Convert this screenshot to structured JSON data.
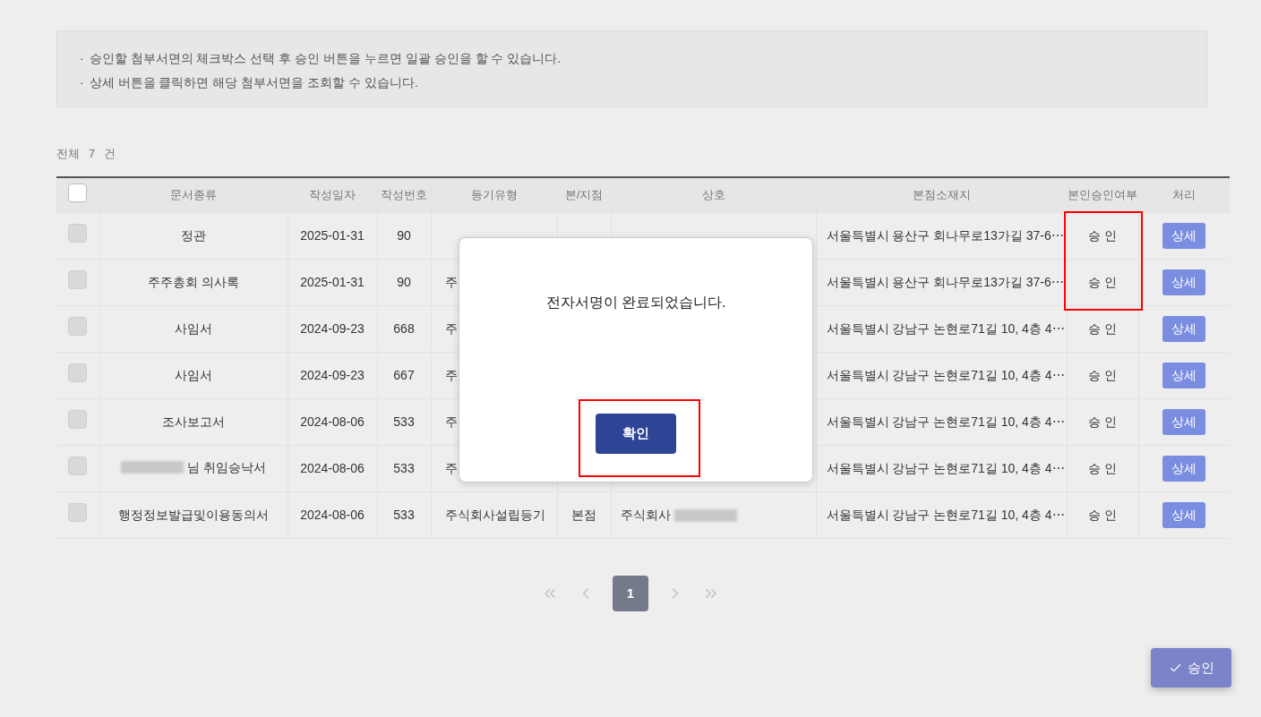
{
  "notice": [
    "승인할 첨부서면의 체크박스 선택 후 승인 버튼을 누르면 일괄 승인을 할 수 있습니다.",
    "상세 버튼을 클릭하면 해당 첨부서면을 조회할 수 있습니다."
  ],
  "bullet": "·",
  "total": {
    "prefix": "전체",
    "count": "7",
    "suffix": "건"
  },
  "table": {
    "select_all": {
      "checked": false
    },
    "columns": [
      "문서종류",
      "작성일자",
      "작성번호",
      "등기유형",
      "본/지점",
      "상호",
      "본점소재지",
      "본인승인여부",
      "처리"
    ],
    "rows": [
      {
        "checked": false,
        "doc_type": [
          {
            "kind": "text",
            "text": "정관"
          }
        ],
        "date": "2025-01-31",
        "number": "90",
        "address": "서울특별시 용산구 회나무로13가길 37-6⋯",
        "approval": "승 인",
        "action": "상세"
      },
      {
        "checked": false,
        "doc_type": [
          {
            "kind": "text",
            "text": "주주총회 의사록"
          }
        ],
        "date": "2025-01-31",
        "number": "90",
        "reg_type": "주",
        "address": "서울특별시 용산구 회나무로13가길 37-6⋯",
        "approval": "승 인",
        "action": "상세"
      },
      {
        "checked": false,
        "doc_type": [
          {
            "kind": "text",
            "text": "사임서"
          }
        ],
        "date": "2024-09-23",
        "number": "668",
        "reg_type": "주",
        "address": "서울특별시 강남구 논현로71길 10, 4층 4⋯",
        "approval": "승 인",
        "action": "상세"
      },
      {
        "checked": false,
        "doc_type": [
          {
            "kind": "text",
            "text": "사임서"
          }
        ],
        "date": "2024-09-23",
        "number": "667",
        "reg_type": "주",
        "address": "서울특별시 강남구 논현로71길 10, 4층 4⋯",
        "approval": "승 인",
        "action": "상세"
      },
      {
        "checked": false,
        "doc_type": [
          {
            "kind": "text",
            "text": "조사보고서"
          }
        ],
        "date": "2024-08-06",
        "number": "533",
        "reg_type": "주",
        "address": "서울특별시 강남구 논현로71길 10, 4층 4⋯",
        "approval": "승 인",
        "action": "상세"
      },
      {
        "checked": false,
        "doc_type": [
          {
            "kind": "redacted"
          },
          {
            "kind": "text",
            "text": "님 취임승낙서"
          }
        ],
        "date": "2024-08-06",
        "number": "533",
        "reg_type": "주",
        "address": "서울특별시 강남구 논현로71길 10, 4층 4⋯",
        "approval": "승 인",
        "action": "상세"
      },
      {
        "checked": false,
        "doc_type": [
          {
            "kind": "text",
            "text": "행정정보발급및이용동의서"
          }
        ],
        "date": "2024-08-06",
        "number": "533",
        "reg_type": "주식회사설립등기",
        "branch": "본점",
        "company": [
          {
            "kind": "text",
            "text": "주식회사"
          },
          {
            "kind": "redacted"
          }
        ],
        "address": "서울특별시 강남구 논현로71길 10, 4층 4⋯",
        "approval": "승 인",
        "action": "상세"
      }
    ]
  },
  "pagination": {
    "pages": [
      {
        "label": "1",
        "selected": true
      }
    ]
  },
  "dialog": {
    "message": "전자서명이 완료되었습니다.",
    "button": "확인"
  },
  "approve_button": "승인"
}
